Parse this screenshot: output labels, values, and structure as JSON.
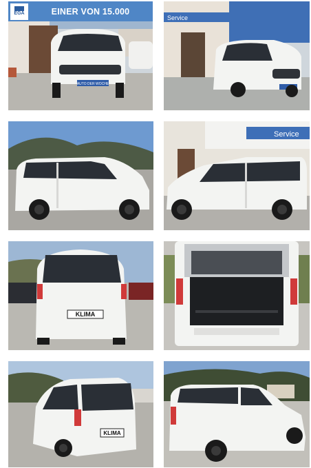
{
  "banner": {
    "logo_text": "EGA",
    "headline": "EINER VON 15.000"
  },
  "gallery": {
    "photos": [
      {
        "label": "front",
        "dealer_plate": "AUTO DER WOCHE"
      },
      {
        "label": "front-left",
        "dealer_sign": "Service",
        "dealer_plate": "AUTO DER WOCHE"
      },
      {
        "label": "side-left"
      },
      {
        "label": "side-right",
        "dealer_sign": "Service"
      },
      {
        "label": "rear",
        "plate": "KLIMA"
      },
      {
        "label": "cargo-open"
      },
      {
        "label": "rear-left",
        "plate": "KLIMA"
      },
      {
        "label": "side-right-rear"
      }
    ]
  },
  "colors": {
    "car": "#f3f4f2",
    "glass": "#2a2f36",
    "banner": "#4f86c6"
  }
}
